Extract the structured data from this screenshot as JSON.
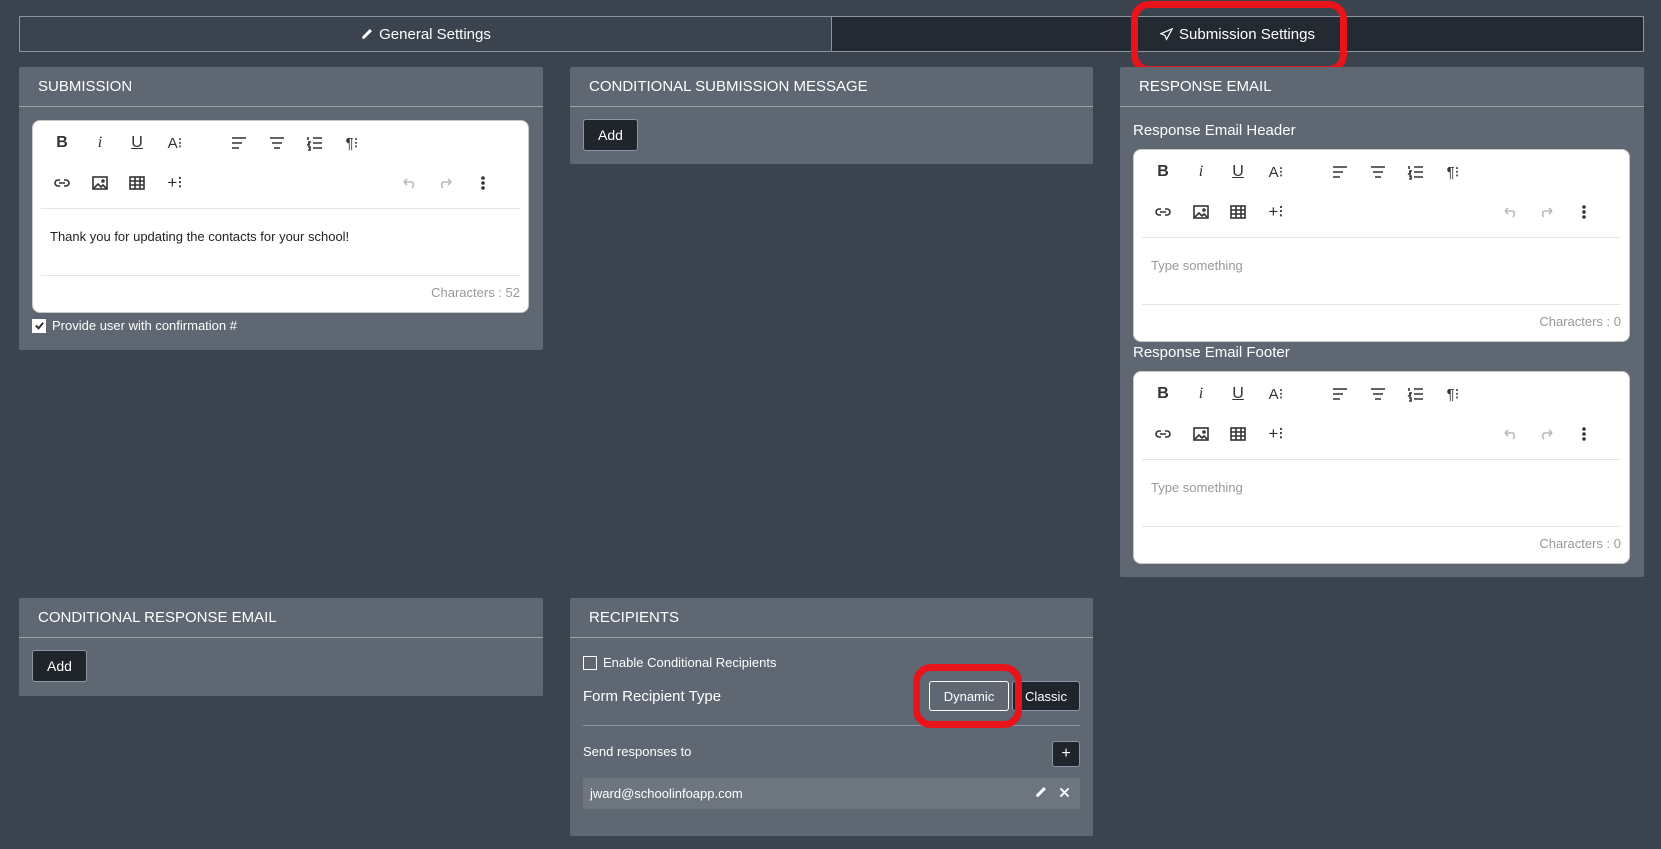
{
  "tabs": {
    "general": "General Settings",
    "submission": "Submission Settings"
  },
  "submission": {
    "title": "SUBMISSION",
    "content": "Thank you for updating the contacts for your school!",
    "counter": "Characters : 52",
    "confirmation_label": "Provide user with confirmation #",
    "confirmation_checked": true
  },
  "conditional_submission": {
    "title": "CONDITIONAL SUBMISSION MESSAGE",
    "add_label": "Add"
  },
  "response_email": {
    "title": "RESPONSE EMAIL",
    "header_label": "Response Email Header",
    "header_placeholder": "Type something",
    "header_counter": "Characters : 0",
    "footer_label": "Response Email Footer",
    "footer_placeholder": "Type something",
    "footer_counter": "Characters : 0"
  },
  "conditional_response": {
    "title": "CONDITIONAL RESPONSE EMAIL",
    "add_label": "Add"
  },
  "recipients": {
    "title": "RECIPIENTS",
    "enable_conditional_label": "Enable Conditional Recipients",
    "recipient_type_label": "Form Recipient Type",
    "dynamic_label": "Dynamic",
    "classic_label": "Classic",
    "send_to_label": "Send responses to",
    "add_symbol": "+",
    "emails": [
      "jward@schoolinfoapp.com"
    ]
  },
  "toolbar": {
    "bold": "B",
    "italic": "i",
    "underline": "U",
    "font_size": "A⁝",
    "paragraph": "¶⁝",
    "insert_more": "+⁝"
  },
  "colors": {
    "background": "#3a434e",
    "panel": "#5f6872",
    "highlight": "#e8131b",
    "dark_button": "#1f252b"
  }
}
